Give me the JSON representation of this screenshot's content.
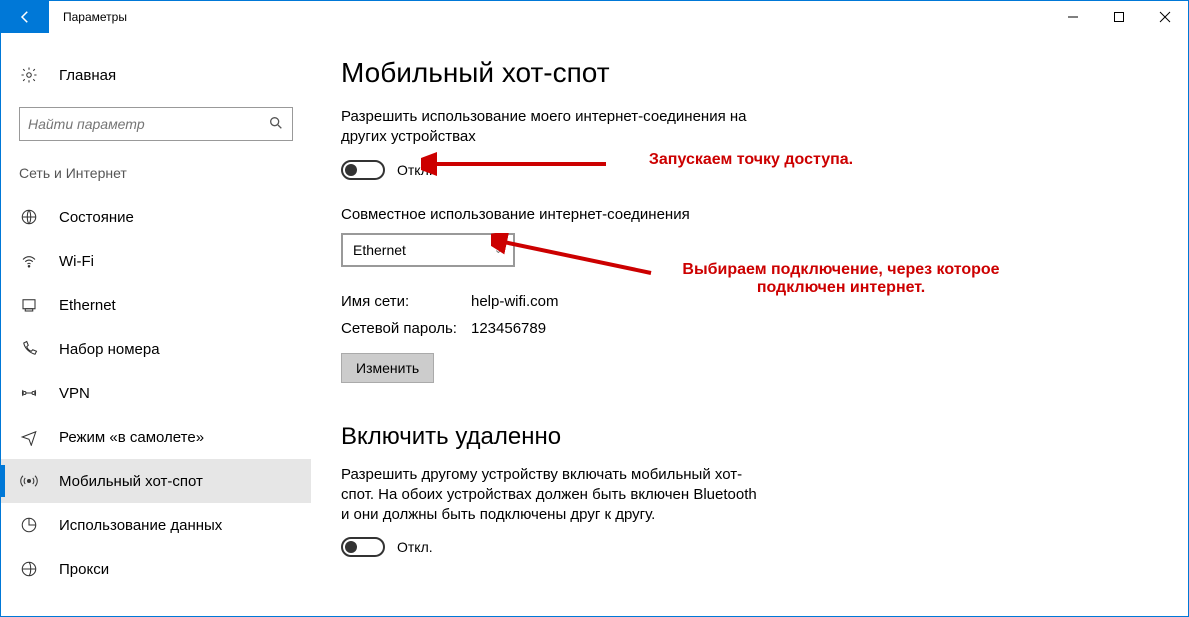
{
  "window": {
    "title": "Параметры"
  },
  "sidebar": {
    "home": "Главная",
    "search_placeholder": "Найти параметр",
    "group": "Сеть и Интернет",
    "items": [
      {
        "label": "Состояние"
      },
      {
        "label": "Wi-Fi"
      },
      {
        "label": "Ethernet"
      },
      {
        "label": "Набор номера"
      },
      {
        "label": "VPN"
      },
      {
        "label": "Режим «в самолете»"
      },
      {
        "label": "Мобильный хот-спот",
        "active": true
      },
      {
        "label": "Использование данных"
      },
      {
        "label": "Прокси"
      }
    ]
  },
  "main": {
    "title": "Мобильный хот-спот",
    "share_desc": "Разрешить использование моего интернет-соединения на других устройствах",
    "toggle1_state": "Откл.",
    "share_label": "Совместное использование интернет-соединения",
    "connection_selected": "Ethernet",
    "net_name_label": "Имя сети:",
    "net_name_value": "help-wifi.com",
    "net_pass_label": "Сетевой пароль:",
    "net_pass_value": "123456789",
    "change_btn": "Изменить",
    "remote_title": "Включить удаленно",
    "remote_desc": "Разрешить другому устройству включать мобильный хот-спот. На обоих устройствах должен быть включен Bluetooth и они должны быть подключены друг к другу.",
    "toggle2_state": "Откл."
  },
  "annotations": {
    "a1": "Запускаем точку доступа.",
    "a2": "Выбираем подключение, через которое подключен интернет."
  }
}
